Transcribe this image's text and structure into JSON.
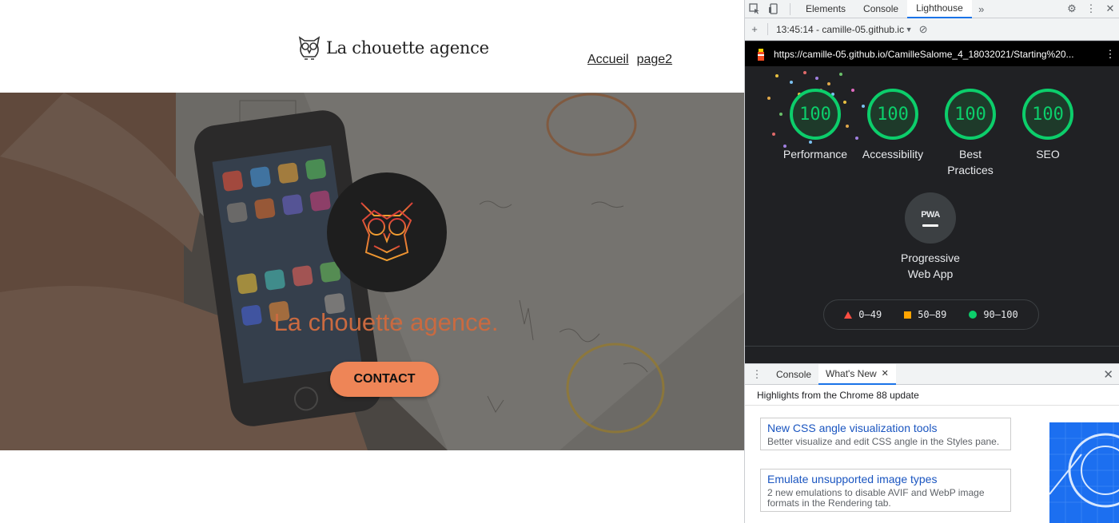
{
  "site": {
    "logo_text": "La chouette agence",
    "nav": [
      "Accueil",
      "page2"
    ],
    "hero_title": "La chouette agence.",
    "contact_label": "CONTACT"
  },
  "devtools": {
    "tabs": [
      "Elements",
      "Console",
      "Lighthouse"
    ],
    "active_tab": "Lighthouse",
    "report_select": "13:45:14 - camille-05.github.ic",
    "report_url": "https://camille-05.github.io/CamilleSalome_4_18032021/Starting%20...",
    "scores": [
      {
        "label": "Performance",
        "value": "100"
      },
      {
        "label": "Accessibility",
        "value": "100"
      },
      {
        "label": "Best Practices",
        "value": "100"
      },
      {
        "label": "SEO",
        "value": "100"
      }
    ],
    "pwa": {
      "badge": "PWA",
      "label": "Progressive Web App"
    },
    "legend": [
      "0–49",
      "50–89",
      "90–100"
    ],
    "colors": {
      "pass": "#0cce6b",
      "average": "#ffa400",
      "fail": "#ff4e42"
    }
  },
  "drawer": {
    "tabs": [
      "Console",
      "What's New"
    ],
    "active_tab": "What's New",
    "heading": "Highlights from the Chrome 88 update",
    "features": [
      {
        "title": "New CSS angle visualization tools",
        "desc": "Better visualize and edit CSS angle in the Styles pane."
      },
      {
        "title": "Emulate unsupported image types",
        "desc": "2 new emulations to disable AVIF and WebP image formats in the Rendering tab."
      }
    ]
  }
}
